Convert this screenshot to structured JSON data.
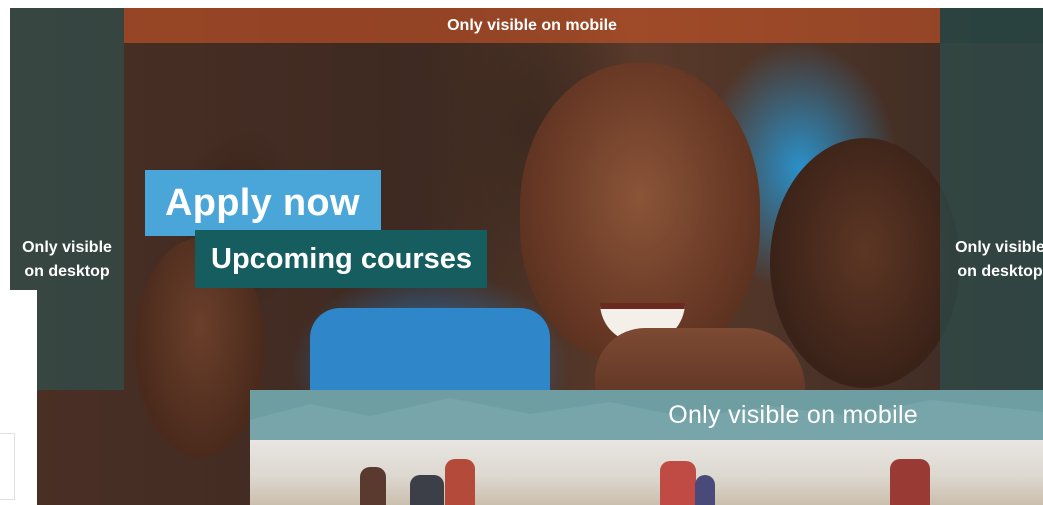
{
  "hero": {
    "top_banner_label": "Only visible on mobile",
    "left_side_label": "Only visible\non desktop",
    "right_side_label": "Only visible\non desktop",
    "apply_label": "Apply now",
    "upcoming_label": "Upcoming courses"
  },
  "mobile_banner": {
    "label": "Only  visible on mobile"
  },
  "colors": {
    "apply_bg": "#4aa6d8",
    "upcoming_bg": "#165d60",
    "mobile_header_bg": "#6e9ea2",
    "top_strip_tint": "#d85a28",
    "side_tint": "#285a5a"
  }
}
